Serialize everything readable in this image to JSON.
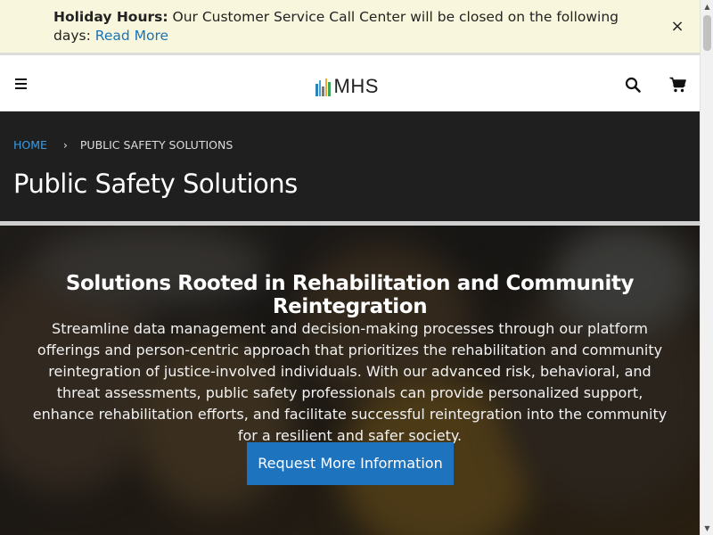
{
  "notice": {
    "heading": "Holiday Hours:",
    "message": "Our Customer Service Call Center will be closed on the following days:",
    "link_text": "Read More",
    "close_glyph": "×"
  },
  "header": {
    "logo_text": "MHS",
    "logo_bar_colors": [
      "#2f7fbf",
      "#4aa0d8",
      "#7a7a7a",
      "#f0a93b",
      "#3aa35c"
    ],
    "icons": [
      "menu-icon",
      "search-icon",
      "cart-icon"
    ]
  },
  "title_banner": {
    "breadcrumb": {
      "home": "Home",
      "separator": "›",
      "current": "Public Safety Solutions"
    },
    "title": "Public Safety Solutions"
  },
  "hero": {
    "title": "Solutions Rooted in Rehabilitation and Community Reintegration",
    "body": "Streamline data management and decision-making processes through our platform offerings and person-centric approach that prioritizes the rehabilitation and community reintegration of justice-involved individuals. With our advanced risk, behavioral, and threat assessments, public safety professionals can provide personalized support, enhance rehabilitation efforts, and facilitate successful reintegration into the community for a resilient and safer society.",
    "cta_label": "Request More Information"
  },
  "colors": {
    "notice_bg": "#f8f7dd",
    "link": "#1a73b7",
    "banner_bg": "#1f1f1f",
    "breadcrumb_home": "#3d9ae0",
    "cta_bg": "#1e73be"
  }
}
